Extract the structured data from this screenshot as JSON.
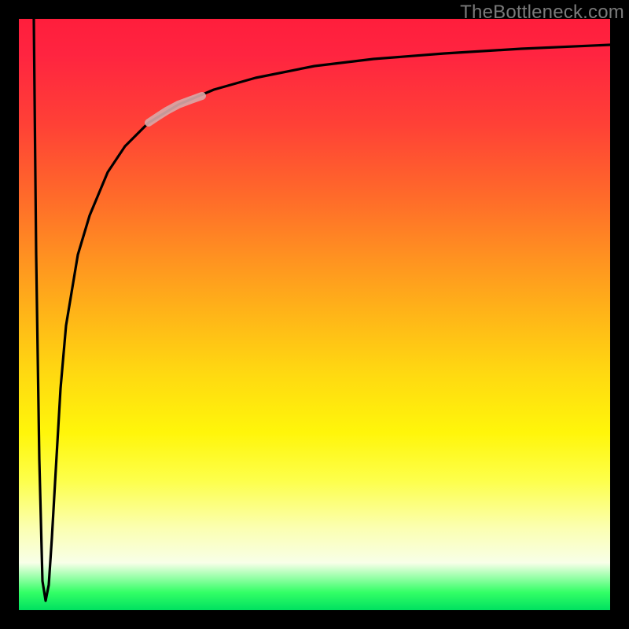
{
  "watermark": "TheBottleneck.com",
  "chart_data": {
    "type": "line",
    "title": "",
    "xlabel": "",
    "ylabel": "",
    "xlim": [
      0,
      100
    ],
    "ylim": [
      0,
      100
    ],
    "grid": false,
    "legend": false,
    "annotations": [],
    "series": [
      {
        "name": "curve",
        "color": "#000000",
        "x": [
          2.5,
          3,
          3.5,
          4,
          4.5,
          5,
          5.5,
          6,
          7,
          8,
          10,
          12,
          15,
          18,
          22,
          27,
          33,
          40,
          50,
          60,
          72,
          85,
          100
        ],
        "y": [
          100,
          60,
          25,
          5,
          2,
          4,
          12,
          22,
          38,
          48,
          60,
          67,
          74,
          78.5,
          82.5,
          85.5,
          88,
          90,
          92,
          93.2,
          94.2,
          95,
          95.6
        ]
      },
      {
        "name": "highlight-segment",
        "color": "#d9a8a8",
        "x": [
          22,
          23.5,
          25,
          27,
          29,
          31
        ],
        "y": [
          82.5,
          83.3,
          84,
          85,
          85.8,
          86.5
        ]
      }
    ]
  },
  "colors": {
    "page_background": "#000000",
    "curve": "#000000",
    "highlight": "#d9a8a8"
  }
}
